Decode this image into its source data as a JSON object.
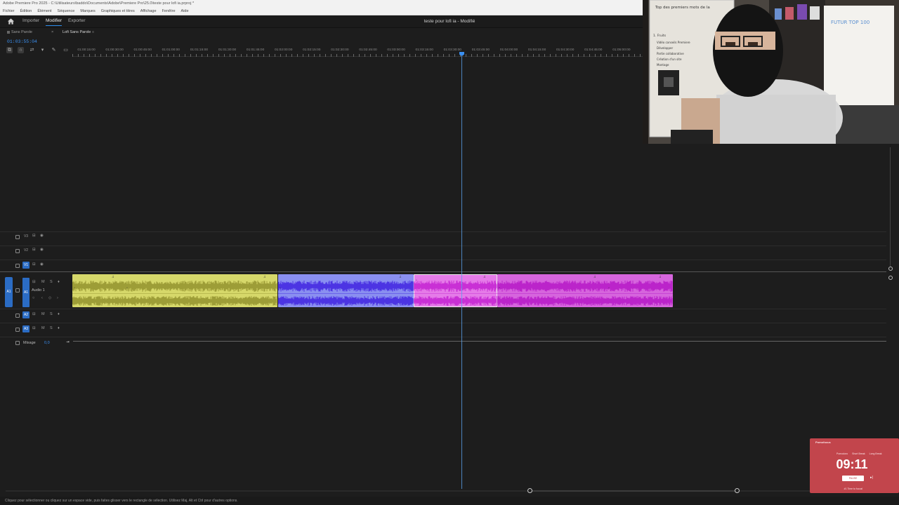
{
  "window": {
    "title": "Adobe Premiere Pro 2025 - C:\\Utilisateurs\\baddo\\Documents\\Adobe\\Premiere Pro\\25.0\\teste pour lofi ia.prproj *"
  },
  "menu": [
    "Fichier",
    "Édition",
    "Élément",
    "Séquence",
    "Marques",
    "Graphiques et titres",
    "Affichage",
    "Fenêtre",
    "Aide"
  ],
  "workspace_tabs": [
    {
      "label": "Importer",
      "active": false
    },
    {
      "label": "Modifier",
      "active": true
    },
    {
      "label": "Exporter",
      "active": false
    }
  ],
  "document_title": "teste pour lofi ia - Modifié",
  "sequence_tabs": [
    {
      "label": "Sans Parole",
      "active": false
    },
    {
      "label": "Lofi Sans Parole",
      "active": true
    }
  ],
  "timecode": "01:03:55:04",
  "ruler_labels": [
    "01:00:15:00",
    "01:00:30:00",
    "01:00:45:00",
    "01:01:00:00",
    "01:01:15:00",
    "01:01:30:00",
    "01:01:45:00",
    "01:02:00:00",
    "01:02:15:00",
    "01:02:30:00",
    "01:02:45:00",
    "01:03:00:00",
    "01:03:15:00",
    "01:03:30:00",
    "01:03:45:00",
    "01:04:00:00",
    "01:04:15:00",
    "01:04:30:00",
    "01:04:45:00",
    "01:05:00:00",
    "01:05:15:00"
  ],
  "tracks": {
    "video": [
      {
        "label": "V3",
        "targeted": false
      },
      {
        "label": "V2",
        "targeted": false
      },
      {
        "label": "V1",
        "targeted": true
      }
    ],
    "audio": [
      {
        "label": "A1",
        "name": "Audio 1",
        "targeted": true,
        "source_patch": "A1"
      },
      {
        "label": "A2",
        "targeted": true
      },
      {
        "label": "A3",
        "targeted": true
      }
    ],
    "mix": {
      "label": "Mixage",
      "value": "0,0"
    }
  },
  "track_toggles": {
    "mute": "M",
    "solo": "S"
  },
  "clips": [
    {
      "color": "#d6d86a",
      "wave": "#8f8f2b",
      "selected": false
    },
    {
      "color": "#8a8ff0",
      "wave": "#3d1ee0",
      "selected": false
    },
    {
      "color": "#e57be8",
      "wave": "#c21fd0",
      "selected": true
    },
    {
      "color": "#d665dd",
      "wave": "#b414c6",
      "selected": false
    }
  ],
  "colors": {
    "accent": "#2d8ceb",
    "playhead": "#3a8ff0",
    "timer_bg": "#c2454c"
  },
  "status_bar": "Cliquez pour sélectionner ou cliquez sur un espace vide, puis faites glisser vers le rectangle de sélection. Utilisez Maj, Alt et Ctrl pour d'autres options.",
  "timer_widget": {
    "app_name": "Pomofocus",
    "modes": [
      "Pomodoro",
      "Short Break",
      "Long Break"
    ],
    "time": "09:11",
    "button": "PAUSE",
    "count": "#1",
    "message": "Time to focus!"
  },
  "webcam": {
    "board_lines": [
      "Top des premiers mots de la",
      "1. Fruits",
      "Vidéo conseils Premiere",
      "Développer",
      "Partie collaborative",
      "Création d'un site",
      "Montage"
    ],
    "poster_text": "FUTUR TOP 100"
  }
}
